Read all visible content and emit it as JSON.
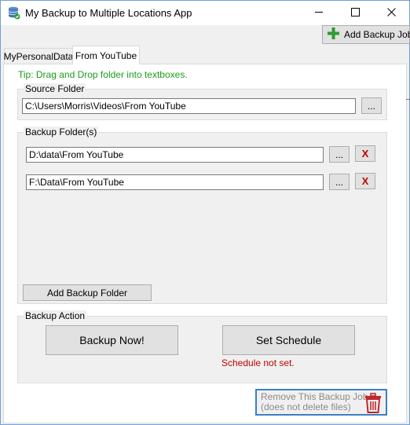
{
  "window": {
    "title": "My Backup to Multiple Locations App",
    "icon": "database-icon",
    "controls": {
      "minimize": "minimize-icon",
      "maximize": "maximize-icon",
      "close": "close-icon"
    }
  },
  "toolbar": {
    "add_job_label": "Add Backup Job",
    "add_job_icon": "plus-icon",
    "add_job_icon_color": "#2e9b2e"
  },
  "tabs": [
    {
      "label": "MyPersonalData",
      "selected": false
    },
    {
      "label": "From YouTube",
      "selected": true
    }
  ],
  "tip": {
    "text": "Tip: Drag and Drop folder into textboxes.",
    "color": "#1a9b1a"
  },
  "source": {
    "legend": "Source Folder",
    "path": "C:\\Users\\Morris\\Videos\\From YouTube",
    "browse_label": "..."
  },
  "backup_folders": {
    "legend": "Backup Folder(s)",
    "items": [
      {
        "path": "D:\\data\\From YouTube",
        "browse_label": "...",
        "delete_label": "X"
      },
      {
        "path": "F:\\Data\\From YouTube",
        "browse_label": "...",
        "delete_label": "X"
      }
    ],
    "add_label": "Add Backup Folder"
  },
  "backup_action": {
    "legend": "Backup Action",
    "backup_now_label": "Backup Now!",
    "set_schedule_label": "Set Schedule",
    "schedule_status": "Schedule not set.",
    "status_color": "#c00000"
  },
  "remove_job": {
    "line1": "Remove This Backup Job",
    "line2": "(does not delete files)",
    "icon": "trash-icon",
    "icon_color": "#c0282d"
  }
}
